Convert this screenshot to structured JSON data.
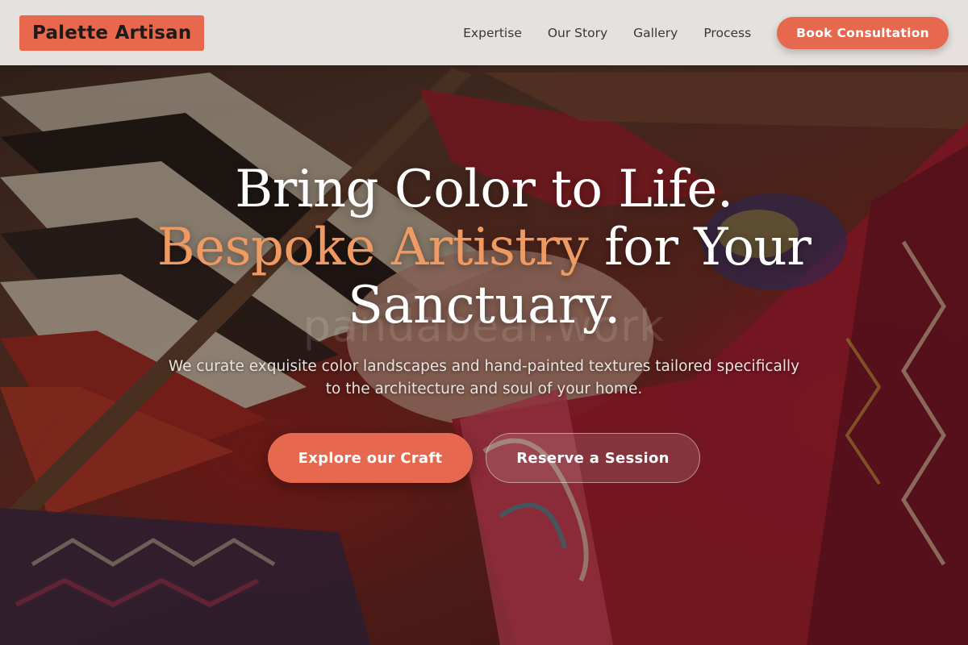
{
  "brand": {
    "name": "Palette Artisan"
  },
  "nav": {
    "items": [
      "Expertise",
      "Our Story",
      "Gallery",
      "Process"
    ],
    "cta": "Book Consultation"
  },
  "hero": {
    "line1": "Bring Color to Life.",
    "accent": "Bespoke Artistry",
    "line2_rest": " for Your Sanctuary.",
    "subtitle": "We curate exquisite color landscapes and hand-painted textures tailored specifically to the architecture and soul of your home.",
    "primary_button": "Explore our Craft",
    "secondary_button": "Reserve a Session",
    "watermark": "pandabear.work",
    "background_image": "weaver-hands-loom-photo"
  },
  "colors": {
    "accent": "#e6694f",
    "headline_accent": "#ef9a62",
    "header_bg": "#ece9e7"
  }
}
